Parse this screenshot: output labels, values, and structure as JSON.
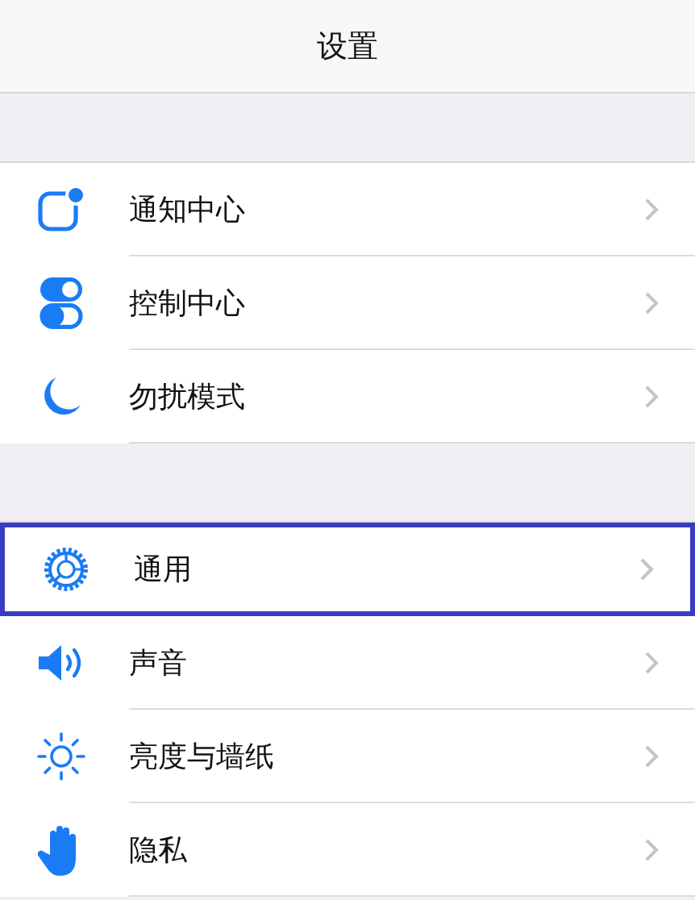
{
  "nav_bar": {
    "title": "设置"
  },
  "groups": [
    {
      "items": [
        {
          "label": "通知中心",
          "highlighted": false
        },
        {
          "label": "控制中心",
          "highlighted": false
        },
        {
          "label": "勿扰模式",
          "highlighted": false
        }
      ]
    },
    {
      "items": [
        {
          "label": "通用",
          "highlighted": true
        },
        {
          "label": "声音",
          "highlighted": false
        },
        {
          "label": "亮度与墙纸",
          "highlighted": false
        },
        {
          "label": "隐私",
          "highlighted": false
        }
      ]
    }
  ]
}
